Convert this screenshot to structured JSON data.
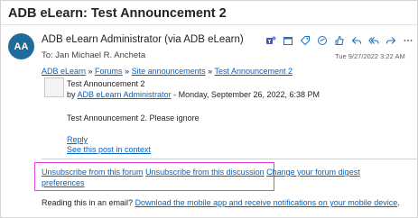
{
  "email": {
    "subject": "ADB eLearn: Test Announcement 2",
    "avatar_initials": "AA",
    "sender": "ADB eLearn Administrator (via ADB eLearn)",
    "recipient": "To:  Jan Michael R. Ancheta",
    "timestamp": "Tue 9/27/2022 3:22 AM"
  },
  "toolbar": {
    "icons": [
      "teams-icon",
      "calendar-icon",
      "tag-icon",
      "sticker-icon",
      "like-icon",
      "reply-icon",
      "reply-all-icon",
      "forward-icon",
      "more-icon"
    ],
    "accent_color": "#1f6fc5"
  },
  "breadcrumb": {
    "home": "ADB eLearn",
    "sep1": " » ",
    "forums": "Forums",
    "sep2": " » ",
    "site": "Site announcements",
    "sep3": " » ",
    "post": "Test Announcement 2"
  },
  "post": {
    "title": "Test Announcement 2",
    "by_prefix": "by ",
    "author": "ADB eLearn Administrator",
    "date": " - Monday, September 26, 2022, 6:38 PM",
    "body": "Test Announcement 2. Please ignore",
    "reply": "Reply",
    "context": "See this post in context"
  },
  "footer": {
    "unsubscribe_forum": "Unsubscribe from this forum",
    "unsubscribe_discussion": "Unsubscribe from this discussion",
    "change_digest_line1": "Change your forum digest",
    "change_digest_line2": "preferences",
    "mobile_prefix": "Reading this in an email? ",
    "mobile_link": "Download the mobile app and receive notifications on your mobile device",
    "mobile_suffix": "."
  },
  "colors": {
    "link": "#0563c1",
    "avatar": "#1f6b9b",
    "highlight": "#e040d8"
  }
}
